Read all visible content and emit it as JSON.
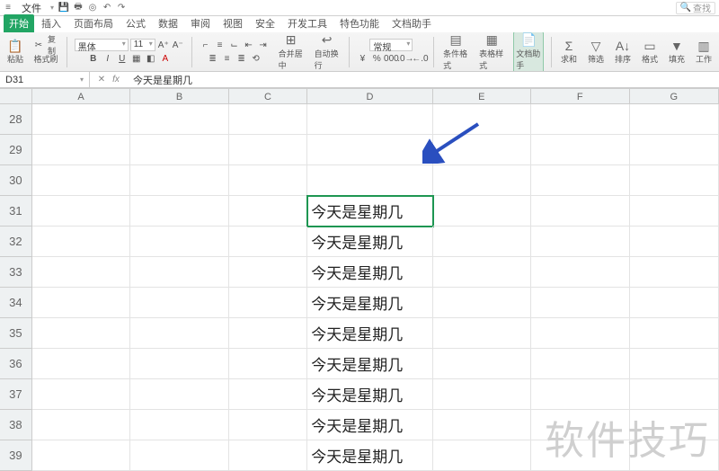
{
  "titlebar": {
    "file": "文件",
    "search_placeholder": "查找"
  },
  "tabs": [
    "开始",
    "插入",
    "页面布局",
    "公式",
    "数据",
    "审阅",
    "视图",
    "安全",
    "开发工具",
    "特色功能",
    "文档助手"
  ],
  "activeTabIndex": 0,
  "ribbon": {
    "paste": "粘贴",
    "copy": "复制",
    "formatPainter": "格式刷",
    "font": "黑体",
    "size": "11",
    "bold": "B",
    "italic": "I",
    "underline": "U",
    "merge": "合并居中",
    "wrap": "自动换行",
    "general": "常规",
    "condFormat": "条件格式",
    "tableStyle": "表格样式",
    "docHelper": "文档助手",
    "sum": "求和",
    "filter": "筛选",
    "sort": "排序",
    "format2": "格式",
    "fill": "填充",
    "work": "工作"
  },
  "namebox": "D31",
  "formula": "今天是星期几",
  "columns": [
    "A",
    "B",
    "C",
    "D",
    "E",
    "F",
    "G"
  ],
  "rowStart": 28,
  "rowEnd": 39,
  "cells": {
    "D31": "今天是星期几",
    "D32": "今天是星期几",
    "D33": "今天是星期几",
    "D34": "今天是星期几",
    "D35": "今天是星期几",
    "D36": "今天是星期几",
    "D37": "今天是星期几",
    "D38": "今天是星期几",
    "D39": "今天是星期几"
  },
  "selected": "D31",
  "watermark": "软件技巧",
  "colors": {
    "accent": "#22a564",
    "selection": "#1e9652"
  }
}
